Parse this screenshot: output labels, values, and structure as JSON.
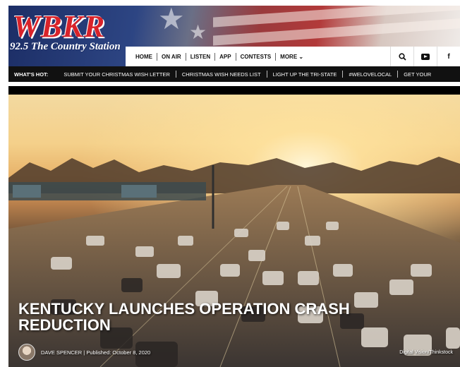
{
  "brand": {
    "logo_text": "WBKR",
    "tagline": "92.5 The Country Station"
  },
  "nav": {
    "items": [
      "HOME",
      "ON AIR",
      "LISTEN",
      "APP",
      "CONTESTS",
      "MORE ⌄"
    ],
    "icons": [
      "search-icon",
      "youtube-icon",
      "facebook-icon"
    ],
    "icon_glyphs": [
      "🔍",
      "",
      "f"
    ]
  },
  "whats_hot": {
    "label": "WHAT'S HOT:",
    "items": [
      "SUBMIT YOUR CHRISTMAS WISH LETTER",
      "CHRISTMAS WISH NEEDS LIST",
      "LIGHT UP THE TRI-STATE",
      "#WELOVELOCAL",
      "GET YOUR"
    ]
  },
  "article": {
    "headline": "KENTUCKY LAUNCHES OPERATION CRASH REDUCTION",
    "author": "DAVE SPENCER",
    "published": "Published: October 8, 2020",
    "byline_full": "DAVE SPENCER | Published: October 8, 2020",
    "photo_credit": "Digital Vision/Thinkstock"
  },
  "colors": {
    "logo_red": "#d8232a",
    "flag_blue": "#1c2e66",
    "hotbar_bg": "#111111"
  }
}
